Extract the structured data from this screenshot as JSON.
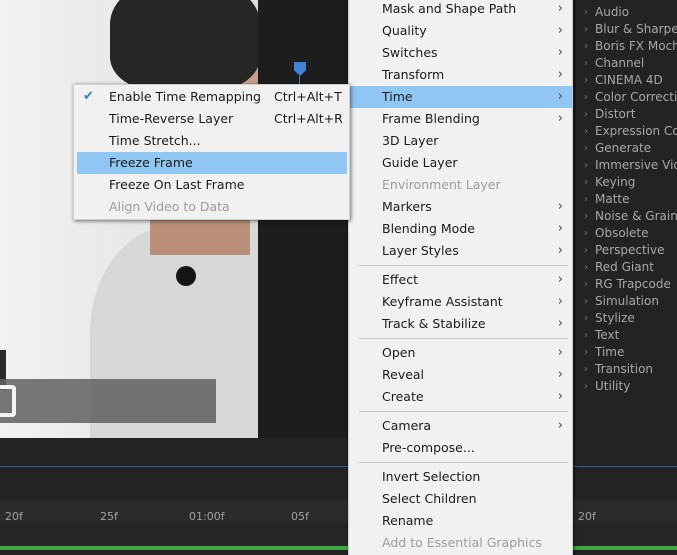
{
  "main_menu": {
    "items": [
      {
        "label": "Mask and Shape Path",
        "submenu": true,
        "enabled": true
      },
      {
        "label": "Quality",
        "submenu": true,
        "enabled": true
      },
      {
        "label": "Switches",
        "submenu": true,
        "enabled": true
      },
      {
        "label": "Transform",
        "submenu": true,
        "enabled": true
      },
      {
        "label": "Time",
        "submenu": true,
        "enabled": true,
        "highlighted": true
      },
      {
        "label": "Frame Blending",
        "submenu": true,
        "enabled": true
      },
      {
        "label": "3D Layer",
        "submenu": false,
        "enabled": true
      },
      {
        "label": "Guide Layer",
        "submenu": false,
        "enabled": true
      },
      {
        "label": "Environment Layer",
        "submenu": false,
        "enabled": false
      },
      {
        "label": "Markers",
        "submenu": true,
        "enabled": true
      },
      {
        "label": "Blending Mode",
        "submenu": true,
        "enabled": true
      },
      {
        "label": "Layer Styles",
        "submenu": true,
        "enabled": true
      },
      {
        "label": "Effect",
        "submenu": true,
        "enabled": true
      },
      {
        "label": "Keyframe Assistant",
        "submenu": true,
        "enabled": true
      },
      {
        "label": "Track & Stabilize",
        "submenu": true,
        "enabled": true
      },
      {
        "label": "Open",
        "submenu": true,
        "enabled": true
      },
      {
        "label": "Reveal",
        "submenu": true,
        "enabled": true
      },
      {
        "label": "Create",
        "submenu": true,
        "enabled": true
      },
      {
        "label": "Camera",
        "submenu": true,
        "enabled": true
      },
      {
        "label": "Pre-compose...",
        "submenu": false,
        "enabled": true
      },
      {
        "label": "Invert Selection",
        "submenu": false,
        "enabled": true
      },
      {
        "label": "Select Children",
        "submenu": false,
        "enabled": true
      },
      {
        "label": "Rename",
        "submenu": false,
        "enabled": true
      },
      {
        "label": "Add to Essential Graphics",
        "submenu": false,
        "enabled": false
      }
    ],
    "submenu_arrow": "›"
  },
  "time_submenu": {
    "items": [
      {
        "label": "Enable Time Remapping",
        "shortcut": "Ctrl+Alt+T",
        "checked": true,
        "enabled": true
      },
      {
        "label": "Time-Reverse Layer",
        "shortcut": "Ctrl+Alt+R",
        "checked": false,
        "enabled": true
      },
      {
        "label": "Time Stretch...",
        "shortcut": "",
        "checked": false,
        "enabled": true
      },
      {
        "label": "Freeze Frame",
        "shortcut": "",
        "checked": false,
        "enabled": true,
        "highlighted": true
      },
      {
        "label": "Freeze On Last Frame",
        "shortcut": "",
        "checked": false,
        "enabled": true
      },
      {
        "label": "Align Video to Data",
        "shortcut": "",
        "checked": false,
        "enabled": false
      }
    ],
    "check_glyph": "✔"
  },
  "effects_panel": {
    "categories": [
      "Audio",
      "Blur & Sharpen",
      "Boris FX Mocha",
      "Channel",
      "CINEMA 4D",
      "Color Correction",
      "Distort",
      "Expression Controls",
      "Generate",
      "Immersive Video",
      "Keying",
      "Matte",
      "Noise & Grain",
      "Obsolete",
      "Perspective",
      "Red Giant",
      "RG Trapcode",
      "Simulation",
      "Stylize",
      "Text",
      "Time",
      "Transition",
      "Utility"
    ],
    "chevron": "›"
  },
  "timeline": {
    "ticks": [
      "20f",
      "25f",
      "01:00f",
      "05f",
      "20f"
    ]
  },
  "colors": {
    "menu_background": "#f1f1f1",
    "highlight": "#8fc6f2",
    "playhead": "#3f84d8",
    "work_area_bar": "#3da63d"
  }
}
